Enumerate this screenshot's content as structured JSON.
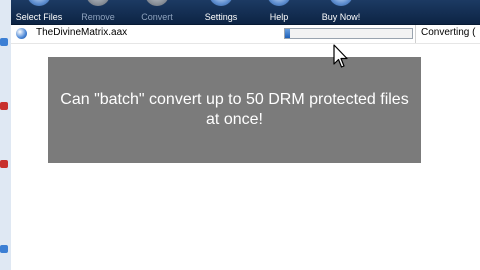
{
  "toolbar": {
    "buttons": [
      {
        "label": "Select Files",
        "icon": "folder-icon",
        "enabled": true
      },
      {
        "label": "Remove",
        "icon": "remove-icon",
        "enabled": false
      },
      {
        "label": "Convert",
        "icon": "convert-icon",
        "enabled": false
      },
      {
        "label": "Settings",
        "icon": "gear-icon",
        "enabled": true
      },
      {
        "label": "Help",
        "icon": "help-icon",
        "enabled": true
      },
      {
        "label": "Buy Now!",
        "icon": "cart-icon",
        "enabled": true
      }
    ]
  },
  "files": [
    {
      "name": "TheDivineMatrix.aax",
      "progress_percent": 4,
      "status": "Converting (",
      "icon": "audio-file-icon"
    }
  ],
  "overlay": {
    "caption": "Can \"batch\" convert up to 50 DRM protected files at once!"
  },
  "colors": {
    "toolbar_bg": "#0d2444",
    "overlay_bg": "#7b7b7b",
    "progress_fill": "#1d5fb8"
  }
}
